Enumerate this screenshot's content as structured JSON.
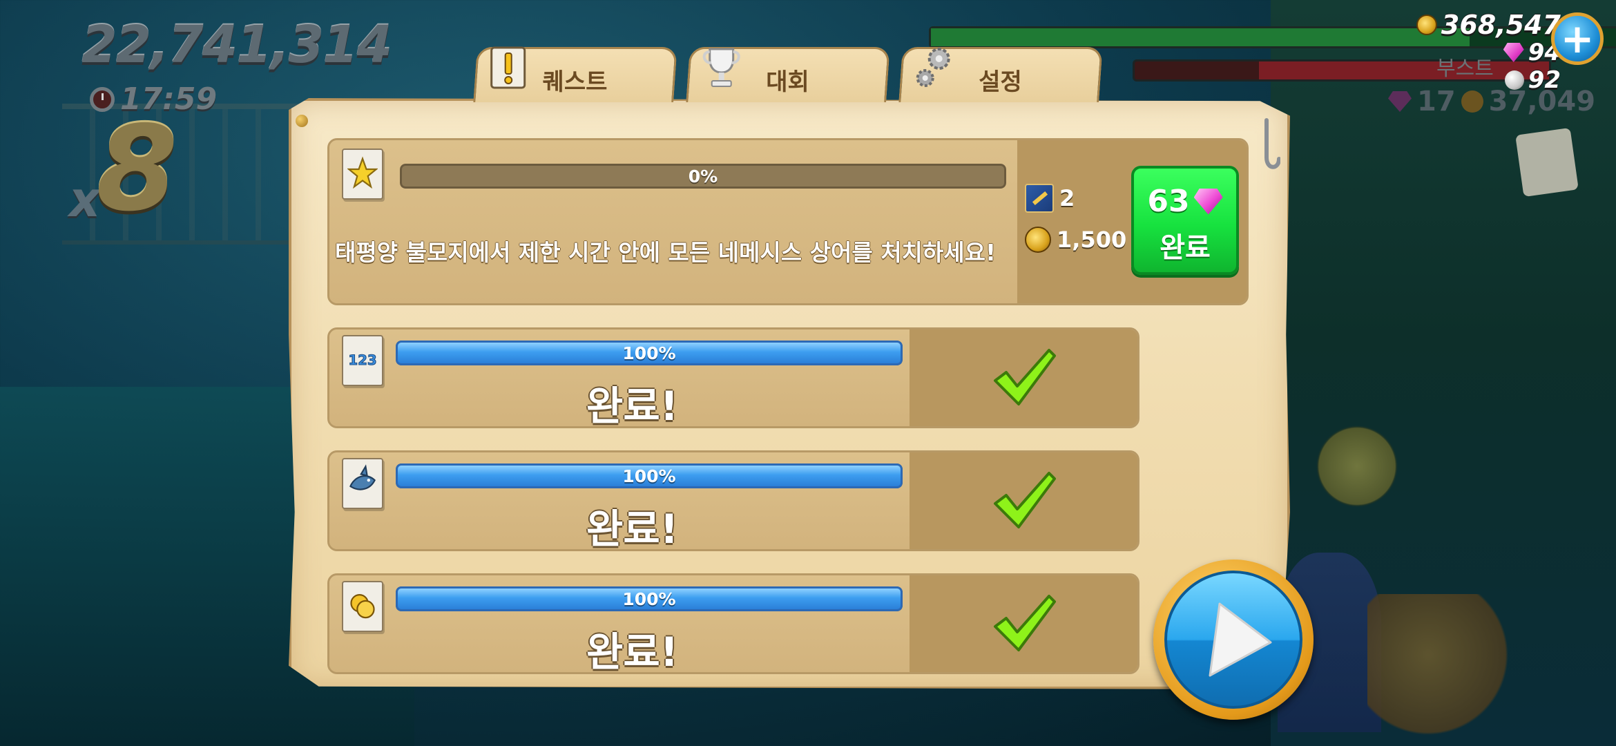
{
  "hud": {
    "score": "22,741,314",
    "timer": "17:59",
    "multiplier_prefix": "x",
    "multiplier": "8",
    "boost_label": "부스트",
    "coins": "368,547",
    "gems": "94",
    "pearls": "92",
    "sub_gems": "17",
    "sub_coins": "37,049"
  },
  "tabs": [
    {
      "label": "퀘스트",
      "icon": "quest-scroll-icon",
      "active": true
    },
    {
      "label": "대회",
      "icon": "trophy-icon",
      "active": false
    },
    {
      "label": "설정",
      "icon": "gears-icon",
      "active": false
    }
  ],
  "quests": [
    {
      "icon": "starfish-quest-icon",
      "progress": 0,
      "progress_label": "0%",
      "description": "태평양 불모지에서 제한 시간 안에 모든 네메시스 상어를 처치하세요!",
      "reward_quest_count": "2",
      "reward_coins": "1,500",
      "complete_cost": "63",
      "complete_label": "완료"
    },
    {
      "icon": "number-123-quest-icon",
      "progress": 100,
      "progress_label": "100%",
      "status": "완료!"
    },
    {
      "icon": "shark-quest-icon",
      "progress": 100,
      "progress_label": "100%",
      "status": "완료!"
    },
    {
      "icon": "coins-quest-icon",
      "progress": 100,
      "progress_label": "100%",
      "status": "완료!"
    }
  ],
  "colors": {
    "panel": "#f1ddb1",
    "progress_blue": "#3d9ef0",
    "complete_green": "#17e23f",
    "check_green": "#8ef21a"
  }
}
